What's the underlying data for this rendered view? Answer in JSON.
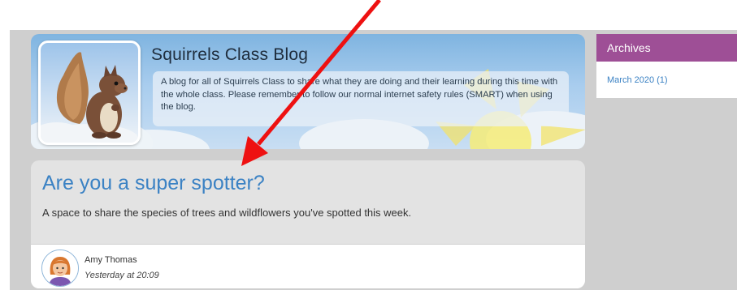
{
  "blog": {
    "title": "Squirrels Class Blog",
    "description": "A blog for all of Squirrels Class to share what they are doing and their learning during this time with the whole class. Please remember to follow our normal internet safety rules (SMART) when using the blog."
  },
  "post": {
    "title": "Are you a super spotter?",
    "summary": "A space to share the species of trees and wildflowers you've spotted this week.",
    "author": "Amy Thomas",
    "time": "Yesterday at 20:09"
  },
  "archives": {
    "heading": "Archives",
    "items": [
      {
        "label": "March 2020 (1)"
      }
    ]
  },
  "colors": {
    "archives_header": "#9e4f96",
    "post_title": "#3b82c4",
    "annotation_arrow": "#ee1111",
    "page_background": "#cfcfcf"
  },
  "icons": {
    "blog_avatar": "squirrel-icon",
    "author_avatar": "user-avatar-icon",
    "annotation": "red-arrow-icon"
  }
}
